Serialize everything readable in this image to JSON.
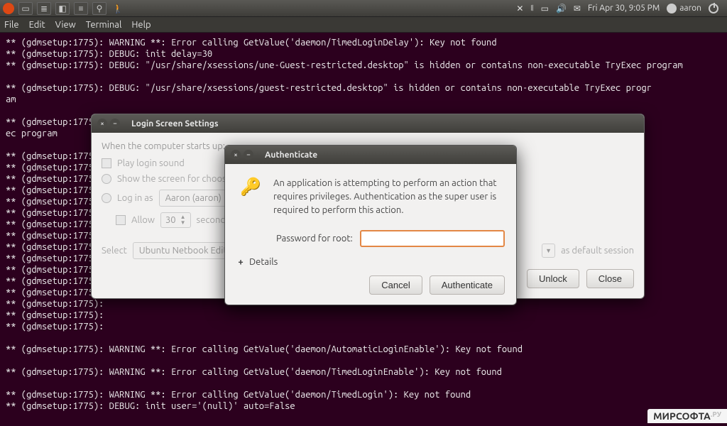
{
  "panel": {
    "date": "Fri Apr 30,  9:05 PM",
    "user": "aaron"
  },
  "menu": {
    "file": "File",
    "edit": "Edit",
    "view": "View",
    "terminal": "Terminal",
    "help": "Help"
  },
  "terminal": {
    "text": "** (gdmsetup:1775): WARNING **: Error calling GetValue('daemon/TimedLoginDelay'): Key not found\n** (gdmsetup:1775): DEBUG: init delay=30\n** (gdmsetup:1775): DEBUG: \"/usr/share/xsessions/une-Guest-restricted.desktop\" is hidden or contains non-executable TryExec program\n\n** (gdmsetup:1775): DEBUG: \"/usr/share/xsessions/guest-restricted.desktop\" is hidden or contains non-executable TryExec progr\nam\n\n** (gdmsetup:1775): DEBUG: \"/usr/share/xsessions/une-guest-restricted.desktop\" is hidden or contains non-executable TryEx\nec program\n\n** (gdmsetup:1775):\n** (gdmsetup:1775):\n** (gdmsetup:1775):\n** (gdmsetup:1775):\n** (gdmsetup:1775):\n** (gdmsetup:1775):\n** (gdmsetup:1775):\n** (gdmsetup:1775):\n** (gdmsetup:1775):\n** (gdmsetup:1775):\n** (gdmsetup:1775):\n** (gdmsetup:1775):\n** (gdmsetup:1775):\n** (gdmsetup:1775):\n** (gdmsetup:1775):\n** (gdmsetup:1775):\n\n** (gdmsetup:1775): WARNING **: Error calling GetValue('daemon/AutomaticLoginEnable'): Key not found\n\n** (gdmsetup:1775): WARNING **: Error calling GetValue('daemon/TimedLoginEnable'): Key not found\n\n** (gdmsetup:1775): WARNING **: Error calling GetValue('daemon/TimedLogin'): Key not found\n** (gdmsetup:1775): DEBUG: init user='(null)' auto=False"
  },
  "login_dialog": {
    "title": "Login Screen Settings",
    "subtitle": "When the computer starts up:",
    "play_sound": "Play login sound",
    "show_screen": "Show the screen for choosing who will log in",
    "login_as": "Log in as",
    "user_combo": "Aaron (aaron)",
    "allow": "Allow",
    "allow_value": "30",
    "allow_suffix": "seconds for anyone else to log in first",
    "select": "Select",
    "session_combo": "Ubuntu Netbook Edition",
    "session_suffix": "as default session",
    "unlock": "Unlock",
    "close": "Close"
  },
  "auth_dialog": {
    "title": "Authenticate",
    "message": "An application is attempting to perform an action that requires privileges. Authentication as the super user is required to perform this action.",
    "pw_label": "Password for root:",
    "details": "Details",
    "cancel": "Cancel",
    "authenticate": "Authenticate"
  },
  "watermark": {
    "text": "МИРСОФТА",
    "suffix": ".РУ"
  }
}
